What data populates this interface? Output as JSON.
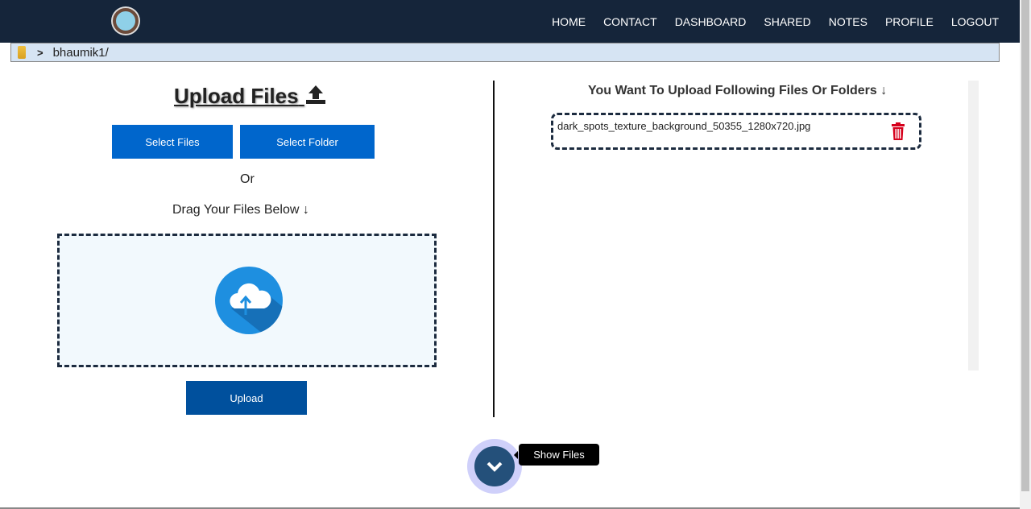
{
  "nav": {
    "items": [
      "HOME",
      "CONTACT",
      "DASHBOARD",
      "SHARED",
      "NOTES",
      "PROFILE",
      "LOGOUT"
    ]
  },
  "breadcrumb": {
    "path": "bhaumik1/"
  },
  "upload": {
    "title": "Upload Files",
    "select_files": "Select Files",
    "select_folder": "Select Folder",
    "or": "Or",
    "drag_text": "Drag Your Files Below",
    "upload_button": "Upload"
  },
  "queue": {
    "title": "You Want To Upload Following Files Or Folders",
    "files": [
      "dark_spots_texture_background_50355_1280x720.jpg"
    ]
  },
  "fab": {
    "tooltip": "Show Files"
  },
  "icons": {
    "breadcrumb": [
      "folder-icon",
      "chevron-right-icon"
    ],
    "title": "upload-icon",
    "drag": "arrow-down-icon",
    "drop_zone": "cloud-upload-icon",
    "queue_title": "arrow-down-icon",
    "file_delete": "trash-icon",
    "fab": "chevron-down-icon"
  },
  "colors": {
    "nav": "#15253a",
    "button": "#0066cc",
    "upload": "#00509d",
    "delete": "#d6001c"
  }
}
